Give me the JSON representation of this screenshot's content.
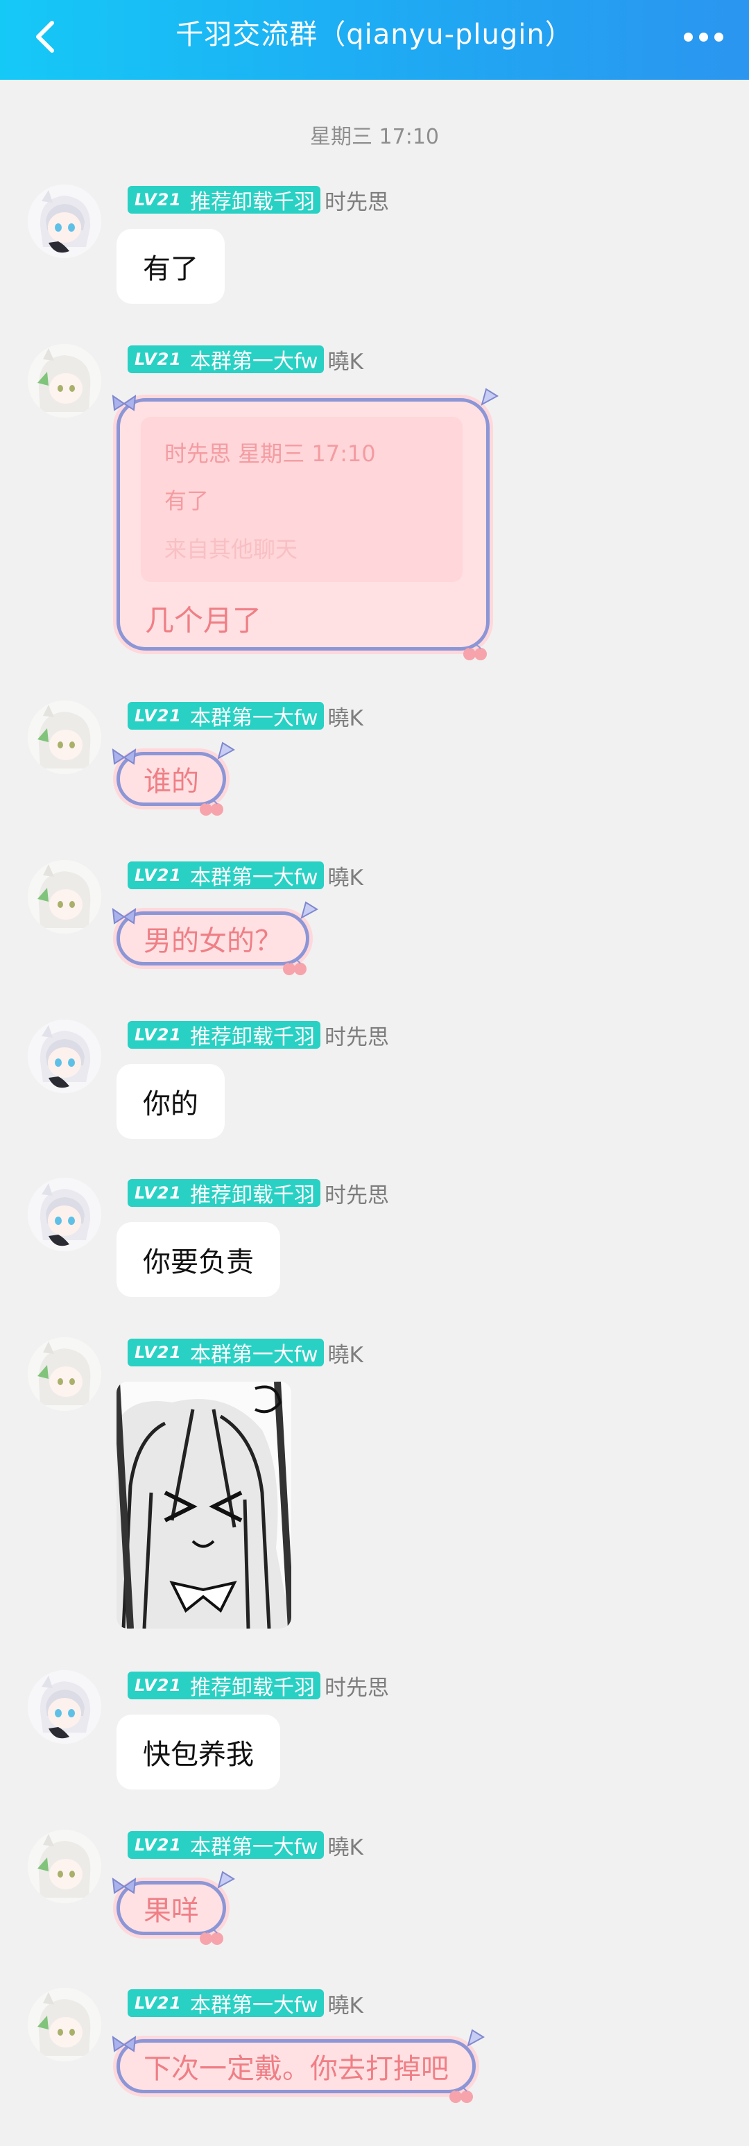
{
  "header": {
    "title": "千羽交流群（qianyu-plugin）",
    "back_icon": "chevron-left-icon",
    "more_icon": "more-dots-icon",
    "gradient": [
      "#15c9f7",
      "#2b95ef"
    ]
  },
  "time_divider": "星期三 17:10",
  "messages": [
    {
      "sender": "时先思",
      "level": "LV21",
      "title": "推荐卸载千羽",
      "type": "text",
      "text": "有了"
    },
    {
      "sender": "曉K",
      "level": "LV21",
      "title": "本群第一大fw",
      "type": "quote",
      "quote": {
        "sender": "时先思",
        "time": "星期三 17:10",
        "text": "有了",
        "source": "来自其他聊天"
      },
      "text": "几个月了"
    },
    {
      "sender": "曉K",
      "level": "LV21",
      "title": "本群第一大fw",
      "type": "text",
      "text": "谁的"
    },
    {
      "sender": "曉K",
      "level": "LV21",
      "title": "本群第一大fw",
      "type": "text",
      "text": "男的女的？"
    },
    {
      "sender": "时先思",
      "level": "LV21",
      "title": "推荐卸载千羽",
      "type": "text",
      "text": "你的"
    },
    {
      "sender": "时先思",
      "level": "LV21",
      "title": "推荐卸载千羽",
      "type": "text",
      "text": "你要负责"
    },
    {
      "sender": "曉K",
      "level": "LV21",
      "title": "本群第一大fw",
      "type": "image",
      "image": "manga-sticker-crying-girl"
    },
    {
      "sender": "时先思",
      "level": "LV21",
      "title": "推荐卸载千羽",
      "type": "text",
      "text": "快包养我"
    },
    {
      "sender": "曉K",
      "level": "LV21",
      "title": "本群第一大fw",
      "type": "text",
      "text": "果咩"
    },
    {
      "sender": "曉K",
      "level": "LV21",
      "title": "本群第一大fw",
      "type": "text",
      "text": "下次一定戴。你去打掉吧"
    }
  ],
  "colors": {
    "badge": "#29d1c4",
    "pink_bubble": "#ffe1e3",
    "pink_text": "#ef7f86",
    "bubble_border": "#8c96d6"
  }
}
